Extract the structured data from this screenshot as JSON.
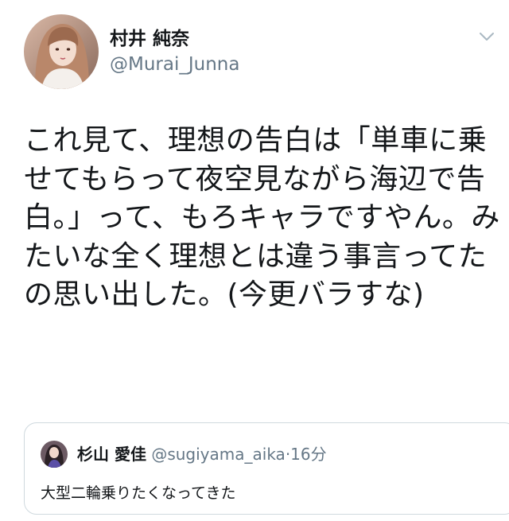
{
  "tweet": {
    "author": {
      "display_name": "村井 純奈",
      "handle": "@Murai_Junna"
    },
    "text": "これ見て、理想の告白は「単車に乗せてもらって夜空見ながら海辺で告白。」って、もろキャラですやん。みたいな全く理想とは違う事言ってたの思い出した。(今更バラすな)",
    "more_icon": "chevron-down-icon"
  },
  "quoted_tweet": {
    "display_name": "杉山 愛佳",
    "handle": "@sugiyama_aika",
    "separator": "·",
    "time": "16分",
    "text": "大型二輪乗りたくなってきた"
  },
  "colors": {
    "text_primary": "#14171a",
    "text_secondary": "#657786",
    "border": "#cfd9de"
  }
}
